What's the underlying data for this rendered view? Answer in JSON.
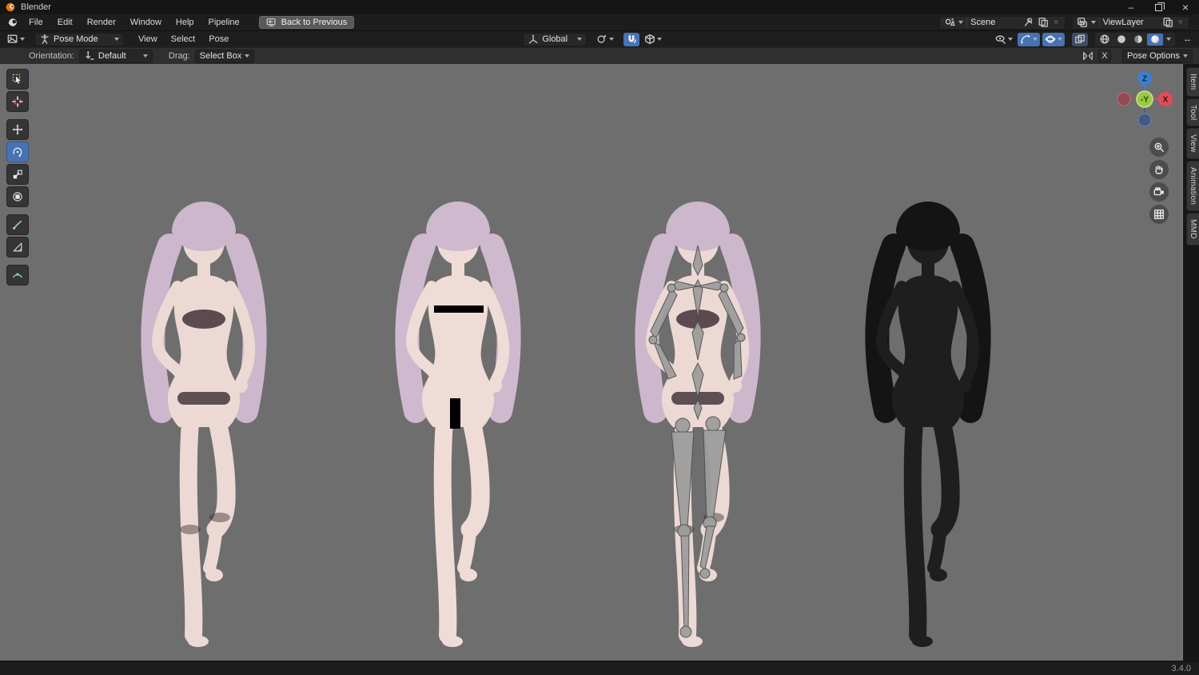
{
  "window": {
    "app_title": "Blender",
    "minimize_glyph": "–",
    "close_glyph": "×"
  },
  "menubar": {
    "items": [
      "File",
      "Edit",
      "Render",
      "Window",
      "Help",
      "Pipeline"
    ],
    "back_button_label": "Back to Previous",
    "scene_selector": {
      "value": "Scene"
    },
    "view_layer_selector": {
      "value": "ViewLayer"
    }
  },
  "viewport_header": {
    "mode_selector": "Pose Mode",
    "menus": [
      "View",
      "Select",
      "Pose"
    ],
    "transform_orientation": "Global"
  },
  "tool_settings": {
    "orientation_label": "Orientation:",
    "orientation_value": "Default",
    "drag_label": "Drag:",
    "drag_value": "Select Box",
    "mirror_axis_label": "X",
    "pose_options_label": "Pose Options"
  },
  "toolbar_tools": [
    "tweak-select",
    "cursor",
    "move",
    "rotate",
    "scale",
    "transform",
    "annotate",
    "measure",
    "pose-breakdowner"
  ],
  "active_tool": "rotate",
  "nav_gizmo": {
    "axis_top": "Z",
    "axis_right": "X",
    "axis_center": "-Y"
  },
  "sidebar_tabs": [
    "Item",
    "Tool",
    "View",
    "Animation",
    "MMD"
  ],
  "statusbar": {
    "version": "3.4.0"
  },
  "viewport": {
    "background": "#6e6e6e",
    "models": [
      {
        "name": "textured-character",
        "variant": "textured-with-outfit",
        "hair": "#cdb7cc",
        "skin": "#ecd9d3"
      },
      {
        "name": "base-mesh-character",
        "variant": "censored-base-mesh",
        "hair": "#cfb9ce",
        "skin": "#efdcd6"
      },
      {
        "name": "armature-character",
        "variant": "textured-with-bones",
        "hair": "#cdb7cc",
        "skin": "#ecd9d3"
      },
      {
        "name": "wireframe-character",
        "variant": "dark-wireframe",
        "hair": "#141414",
        "skin": "#1e1e1e"
      }
    ]
  },
  "colors": {
    "accent_blue": "#4772b3",
    "header_bg": "#1d1d1d",
    "tool_settings_bg": "#2f2f2f",
    "titlebar_bg": "#151515",
    "statusbar_bg": "#1c1c1c",
    "viewport_bg": "#6e6e6e",
    "axis_x_red": "#e24b5a",
    "axis_z_blue": "#3b7fd4",
    "axis_y_green": "#9ac942",
    "bone_gray": "#9d9d9d",
    "censor_black": "#000000"
  }
}
